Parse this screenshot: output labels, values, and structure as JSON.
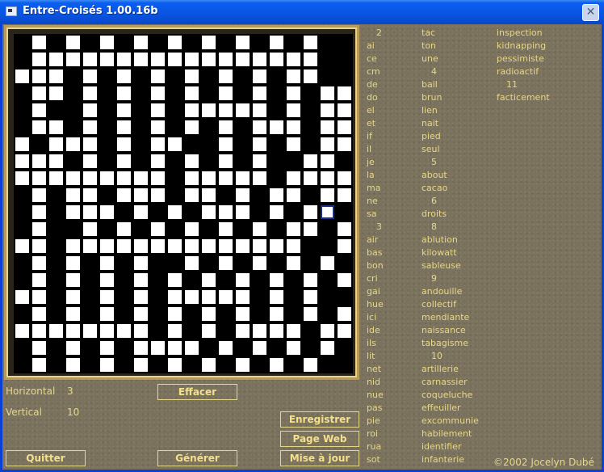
{
  "window": {
    "title": "Entre-Croisés 1.00.16b",
    "close_label": "✕"
  },
  "info": {
    "horizontal_label": "Horizontal",
    "horizontal_value": "3",
    "vertical_label": "Vertical",
    "vertical_value": "10"
  },
  "buttons": {
    "effacer": "Effacer",
    "quitter": "Quitter",
    "generer": "Générer",
    "enregistrer": "Enregistrer",
    "page_web": "Page Web",
    "mise_a_jour": "Mise à jour"
  },
  "grid": {
    "rows": 20,
    "cols": 20,
    "selected_cell": [
      10,
      18
    ],
    "pattern": [
      "#.#.#.#.#.#.#.#.#.##",
      "#.................##",
      "...#.#.#.#.#.#.#..##",
      "#..#.#.#.#.#.#.#.#..",
      "#.##.#.#.#.....#.#..",
      "#..#.#.#.#.#.#...#..",
      ".#...#.#..##.#.#.#..",
      "...#.#.#.#.#.#.##..#",
      ".........#.....#....",
      "#.#..#...#..#.#..#..",
      "#.#...#.#.#...#.#..#",
      "#.##.#.#.#.#.#.#..#.",
      "..#..............##.",
      "#.#.#.#.##.#.#.#.#.#",
      "#.#.#.#.#.#.#.#.#.#.",
      "..#.#.#.#.....#.#.##",
      "#.#.#.#.#.#.#.#.#.#.",
      "........#.#.#....#..",
      "#.#.#.#....#.#.#.#.#",
      "#.#.#.#.#.#.#.#.#.##"
    ]
  },
  "words": {
    "col1": [
      "2",
      "ai",
      "ce",
      "cm",
      "de",
      "do",
      "el",
      "et",
      "if",
      "il",
      "je",
      "la",
      "ma",
      "ne",
      "sa",
      "3",
      "air",
      "bas",
      "bon",
      "cri",
      "gai",
      "hue",
      "ici",
      "ide",
      "ils",
      "lit",
      "net",
      "nid",
      "nue",
      "pas",
      "pie",
      "roi",
      "rua",
      "sot"
    ],
    "col2": [
      "tac",
      "ton",
      "une",
      "4",
      "bail",
      "brun",
      "lien",
      "nait",
      "pied",
      "seul",
      "5",
      "about",
      "cacao",
      "6",
      "droits",
      "8",
      "ablution",
      "kilowatt",
      "sableuse",
      "9",
      "andouille",
      "collectif",
      "mendiante",
      "naissance",
      "tabagisme",
      "10",
      "artillerie",
      "carnassier",
      "coqueluche",
      "effeuiller",
      "excommunie",
      "habilement",
      "identifier",
      "infanterie"
    ],
    "col3": [
      "inspection",
      "kidnapping",
      "pessimiste",
      "radioactif",
      "11",
      "facticement"
    ]
  },
  "copyright": "©2002 Jocelyn Dubé"
}
